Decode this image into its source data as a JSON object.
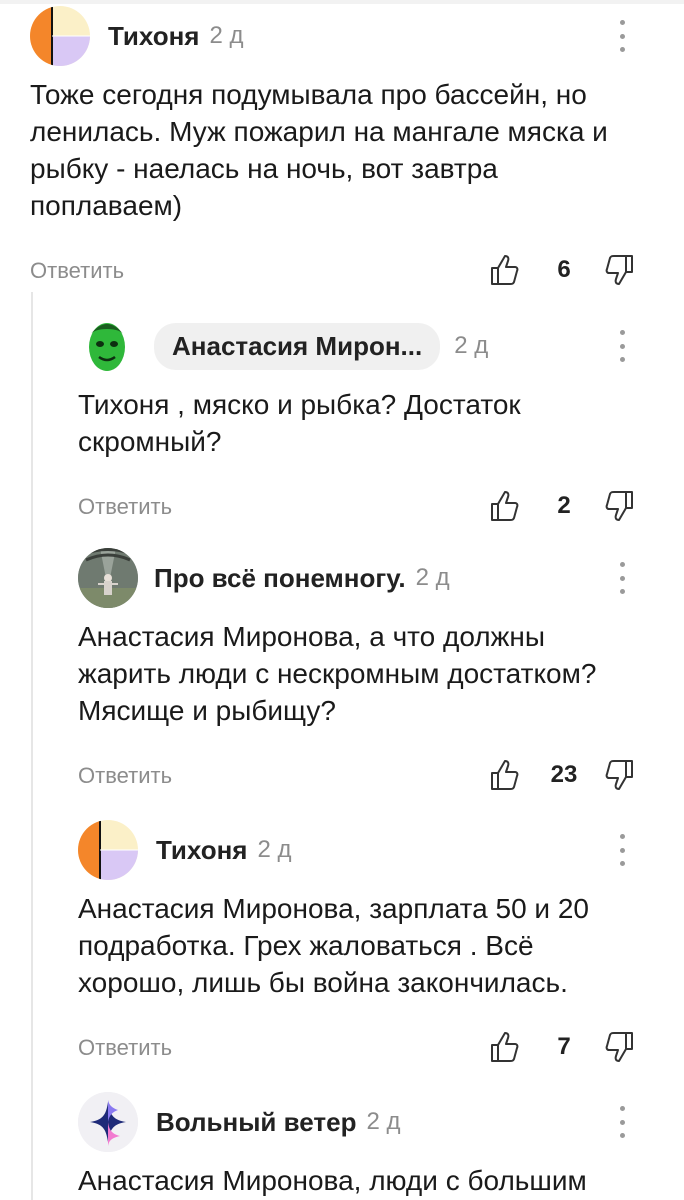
{
  "comments": [
    {
      "author": "Тихоня",
      "time": "2 д",
      "text": "Тоже сегодня подумывала про бассейн, но ленилась. Муж пожарил на мангале мяска и рыбку - наелась на ночь, вот завтра поплаваем)",
      "reply_label": "Ответить",
      "likes": "6",
      "avatar_icon": "color-block-avatar"
    },
    {
      "author": "Анастасия Мирон...",
      "time": "2 д",
      "text": "Тихоня , мяско и рыбка? Достаток скромный?",
      "reply_label": "Ответить",
      "likes": "2",
      "avatar_icon": "green-face-avatar"
    },
    {
      "author": "Про всё понемногу.",
      "time": "2 д",
      "text": "Анастасия Миронова, а что должны жарить люди с нескромным достатком? Мясище и рыбищу?",
      "reply_label": "Ответить",
      "likes": "23",
      "avatar_icon": "photo-avatar"
    },
    {
      "author": "Тихоня",
      "time": "2 д",
      "text": "Анастасия Миронова, зарплата 50 и 20 подработка. Грех жаловаться . Всё хорошо, лишь бы война закончилась.",
      "reply_label": "Ответить",
      "likes": "7",
      "avatar_icon": "color-block-avatar"
    },
    {
      "author": "Вольный ветер",
      "time": "2 д",
      "text": "Анастасия Миронова, люди с большим",
      "avatar_icon": "star-avatar"
    }
  ],
  "colors": {
    "accent_orange": "#f4862a",
    "avatar_purple": "#d9c8f5",
    "avatar_cream": "#fbf0c8",
    "muted_text": "#8c8c8c"
  }
}
